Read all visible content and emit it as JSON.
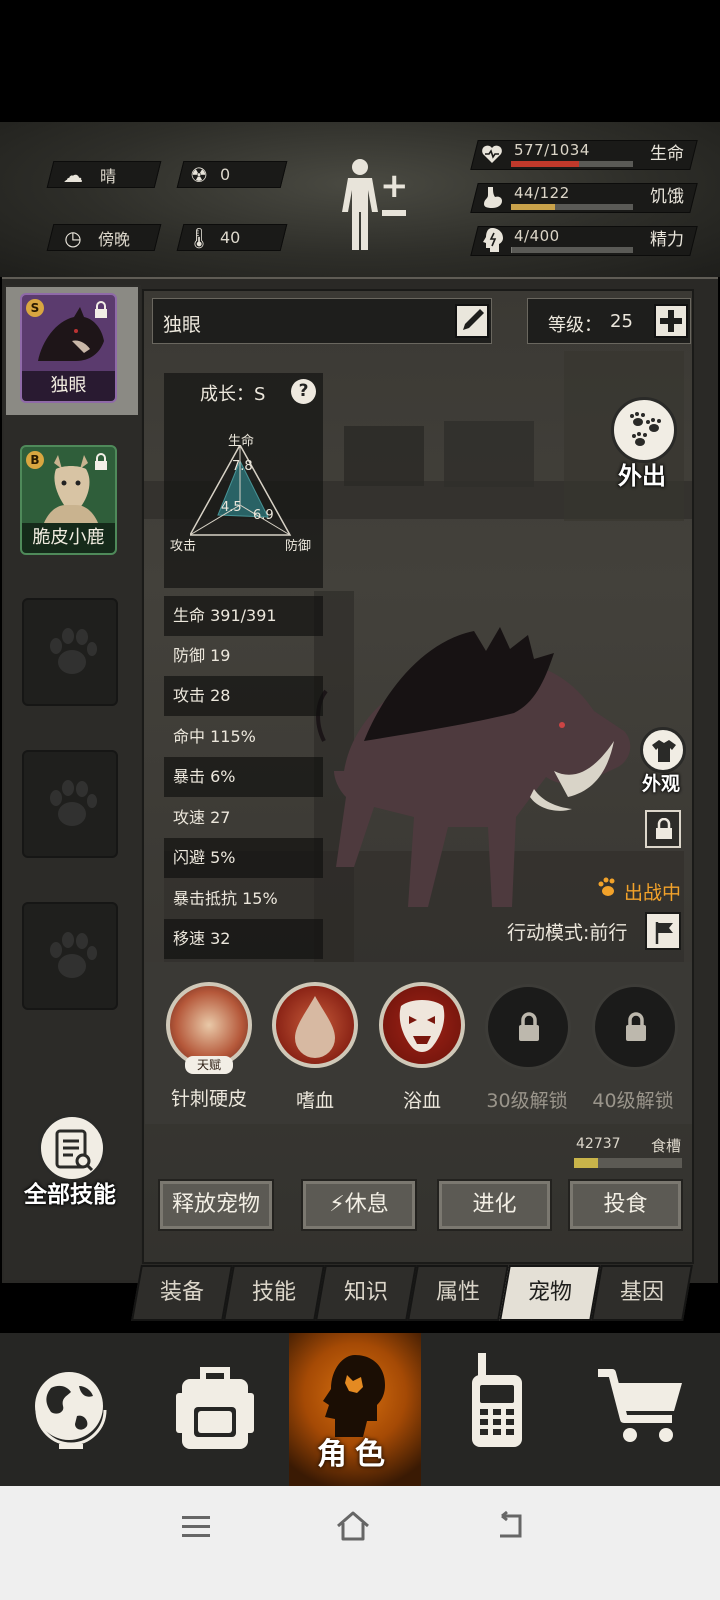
{
  "status": {
    "weather": {
      "icon": "cloud-icon",
      "label": "晴"
    },
    "radiation": {
      "icon": "radiation-icon",
      "value": "0"
    },
    "time_of_day": {
      "icon": "clock-icon",
      "label": "傍晚"
    },
    "temperature": {
      "icon": "thermometer-icon",
      "value": "40"
    },
    "vitals": [
      {
        "icon": "heart-icon",
        "value": "577/1034",
        "label": "生命",
        "fraction": 0.558,
        "color": "#c0392b"
      },
      {
        "icon": "stomach-icon",
        "value": "44/122",
        "label": "饥饿",
        "fraction": 0.36,
        "color": "#c9a24a"
      },
      {
        "icon": "brain-icon",
        "value": "4/400",
        "label": "精力",
        "fraction": 0.01,
        "color": "#7a7a74"
      }
    ]
  },
  "pets": [
    {
      "name": "独眼",
      "grade": "S",
      "color": "#5b3b6e"
    },
    {
      "name": "脆皮小鹿",
      "grade": "B",
      "color": "#2f5e3a"
    }
  ],
  "pet_detail": {
    "name": "独眼",
    "level_label": "等级：",
    "level": "25",
    "growth_label": "成长：S",
    "radar": {
      "top_label": "生命",
      "left_label": "攻击",
      "right_label": "防御",
      "hp": "7.8",
      "atk": "4.5",
      "def": "6.9"
    },
    "stats": [
      "生命 391/391",
      "防御 19",
      "攻击 28",
      "命中 115%",
      "暴击 6%",
      "攻速 27",
      "闪避 5%",
      "暴击抵抗 15%",
      "移速 32"
    ],
    "go_out": "外出",
    "appearance": "外观",
    "in_battle": "出战中",
    "action_mode": "行动模式:前行"
  },
  "skills": [
    {
      "name": "针刺硬皮",
      "tag": "天赋",
      "locked": false
    },
    {
      "name": "嗜血",
      "locked": false
    },
    {
      "name": "浴血",
      "locked": false
    },
    {
      "name": "30级解锁",
      "locked": true
    },
    {
      "name": "40级解锁",
      "locked": true
    }
  ],
  "food": {
    "value": "42737",
    "label": "食槽",
    "fraction": 0.22
  },
  "all_skills": "全部技能",
  "actions": [
    "释放宠物",
    "休息",
    "进化",
    "投食"
  ],
  "tabs": [
    "装备",
    "技能",
    "知识",
    "属性",
    "宠物",
    "基因"
  ],
  "active_tab": 4,
  "nav": [
    "globe-icon",
    "backpack-icon",
    "character-icon",
    "walkie-talkie-icon",
    "cart-icon"
  ],
  "nav_active_label": "角色"
}
